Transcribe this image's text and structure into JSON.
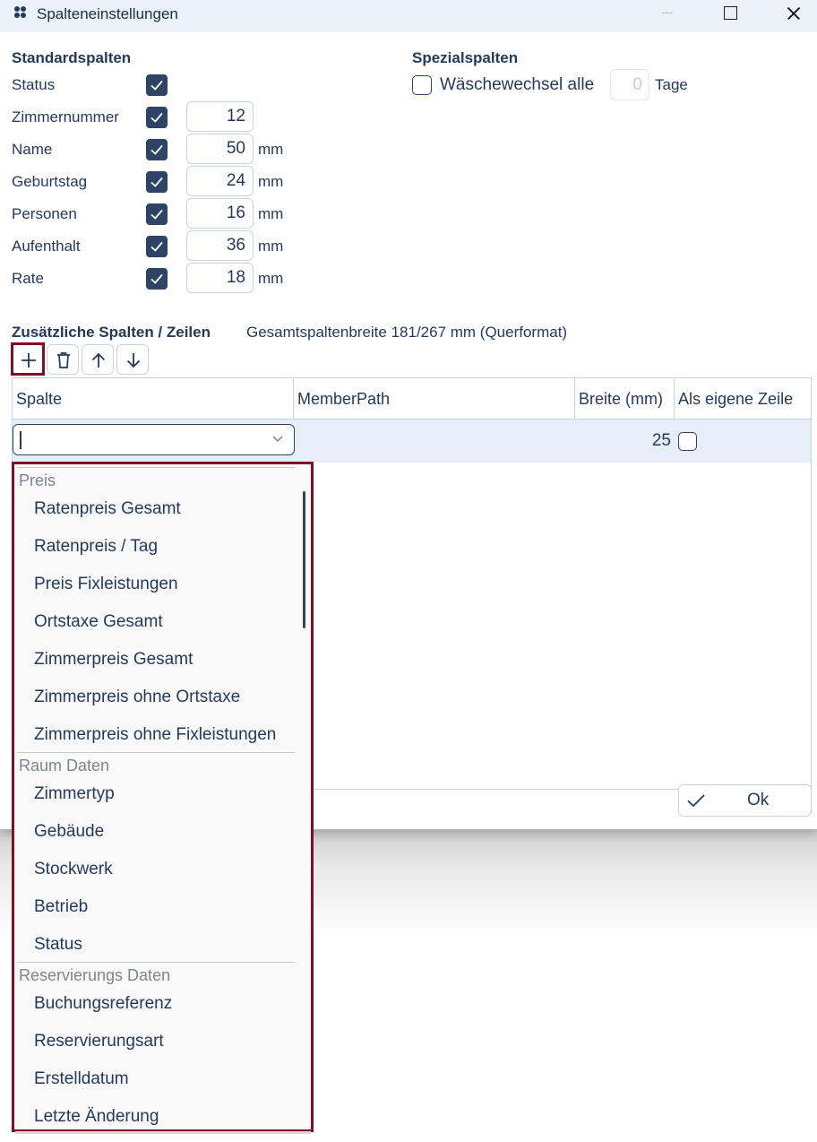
{
  "window": {
    "title": "Spalteneinstellungen"
  },
  "standard": {
    "header": "Standardspalten",
    "rows": [
      {
        "label": "Status",
        "checked": true
      },
      {
        "label": "Zimmernummer",
        "checked": true,
        "value": "12"
      },
      {
        "label": "Name",
        "checked": true,
        "value": "50",
        "unit": "mm"
      },
      {
        "label": "Geburtstag",
        "checked": true,
        "value": "24",
        "unit": "mm"
      },
      {
        "label": "Personen",
        "checked": true,
        "value": "16",
        "unit": "mm"
      },
      {
        "label": "Aufenthalt",
        "checked": true,
        "value": "36",
        "unit": "mm"
      },
      {
        "label": "Rate",
        "checked": true,
        "value": "18",
        "unit": "mm"
      }
    ]
  },
  "special": {
    "header": "Spezialspalten",
    "label": "Wäschewechsel alle",
    "checked": false,
    "days_value": "0",
    "days_unit": "Tage"
  },
  "additional": {
    "header": "Zusätzliche Spalten / Zeilen",
    "info": "Gesamtspaltenbreite 181/267 mm (Querformat)"
  },
  "toolbar": {
    "buttons": [
      {
        "name": "add",
        "icon": "plus-icon"
      },
      {
        "name": "delete",
        "icon": "trash-icon"
      },
      {
        "name": "move-up",
        "icon": "arrow-up-icon"
      },
      {
        "name": "move-down",
        "icon": "arrow-down-icon"
      }
    ]
  },
  "table": {
    "columns": [
      "Spalte",
      "MemberPath",
      "Breite (mm)",
      "Als eigene Zeile"
    ],
    "row": {
      "spalte": "",
      "width": "25",
      "own_row": false
    }
  },
  "dropdown": {
    "groups": [
      {
        "label": "Preis",
        "items": [
          "Ratenpreis Gesamt",
          "Ratenpreis / Tag",
          "Preis Fixleistungen",
          "Ortstaxe Gesamt",
          "Zimmerpreis Gesamt",
          "Zimmerpreis ohne Ortstaxe",
          "Zimmerpreis ohne Fixleistungen"
        ]
      },
      {
        "label": "Raum Daten",
        "items": [
          "Zimmertyp",
          "Gebäude",
          "Stockwerk",
          "Betrieb",
          "Status"
        ]
      },
      {
        "label": "Reservierungs Daten",
        "items": [
          "Buchungsreferenz",
          "Reservierungsart",
          "Erstelldatum",
          "Letzte Änderung"
        ]
      }
    ]
  },
  "ok_button": {
    "label": "Ok",
    "icon": "check-icon"
  },
  "colors": {
    "primary": "#2d4466",
    "highlight": "#7b1326",
    "titlebar": "#e9f2f9",
    "row_selected": "#e6eef7"
  }
}
